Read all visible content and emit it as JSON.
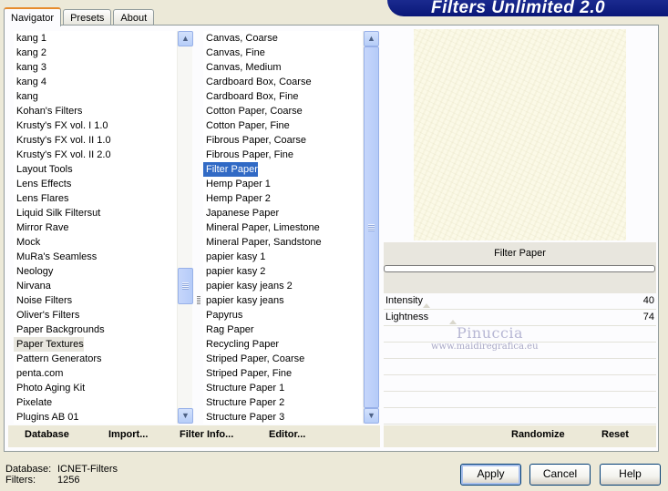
{
  "header": {
    "tabs": [
      {
        "label": "Navigator",
        "active": true
      },
      {
        "label": "Presets",
        "active": false
      },
      {
        "label": "About",
        "active": false
      }
    ],
    "brand": "Filters Unlimited 2.0"
  },
  "categories": {
    "items": [
      "kang 1",
      "kang 2",
      "kang 3",
      "kang 4",
      "kang",
      "Kohan's Filters",
      "Krusty's FX vol. I 1.0",
      "Krusty's FX vol. II 1.0",
      "Krusty's FX vol. II 2.0",
      "Layout Tools",
      "Lens Effects",
      "Lens Flares",
      "Liquid Silk Filtersut",
      "Mirror Rave",
      "Mock",
      "MuRa's Seamless",
      "Neology",
      "Nirvana",
      "Noise Filters",
      "Oliver's Filters",
      "Paper Backgrounds",
      "Paper Textures",
      "Pattern Generators",
      "penta.com",
      "Photo Aging Kit",
      "Pixelate",
      "Plugins AB 01"
    ],
    "highlighted_index": 21,
    "scroll_position": 0.62
  },
  "filters": {
    "items": [
      "Canvas, Coarse",
      "Canvas, Fine",
      "Canvas, Medium",
      "Cardboard Box, Coarse",
      "Cardboard Box, Fine",
      "Cotton Paper, Coarse",
      "Cotton Paper, Fine",
      "Fibrous Paper, Coarse",
      "Fibrous Paper, Fine",
      "Filter Paper",
      "Hemp Paper 1",
      "Hemp Paper 2",
      "Japanese Paper",
      "Mineral Paper, Limestone",
      "Mineral Paper, Sandstone",
      "papier kasy 1",
      "papier kasy 2",
      "papier kasy jeans 2",
      "papier kasy jeans",
      "Papyrus",
      "Rag Paper",
      "Recycling Paper",
      "Striped Paper, Coarse",
      "Striped Paper, Fine",
      "Structure Paper 1",
      "Structure Paper 2",
      "Structure Paper 3"
    ],
    "selected_index": 9,
    "marked_index": 18,
    "scroll_position": 0.0
  },
  "preview": {
    "filter_name": "Filter Paper",
    "progress": 0,
    "watermark_line1": "Pinuccia",
    "watermark_line2": "www.maidiregrafica.eu"
  },
  "sliders": [
    {
      "label": "Intensity",
      "value": "40"
    },
    {
      "label": "Lightness",
      "value": "74"
    }
  ],
  "toolbar": {
    "database": "Database",
    "import": "Import...",
    "filter_info": "Filter Info...",
    "editor": "Editor...",
    "randomize": "Randomize",
    "reset": "Reset"
  },
  "status": {
    "database_label": "Database:",
    "database_value": "ICNET-Filters",
    "filters_label": "Filters:",
    "filters_value": "1256"
  },
  "dialog": {
    "apply": "Apply",
    "cancel": "Cancel",
    "help": "Help"
  },
  "colors": {
    "selection": "#316ac5",
    "brand_bar": "#0a1778",
    "tab_accent": "#e68b2c"
  }
}
